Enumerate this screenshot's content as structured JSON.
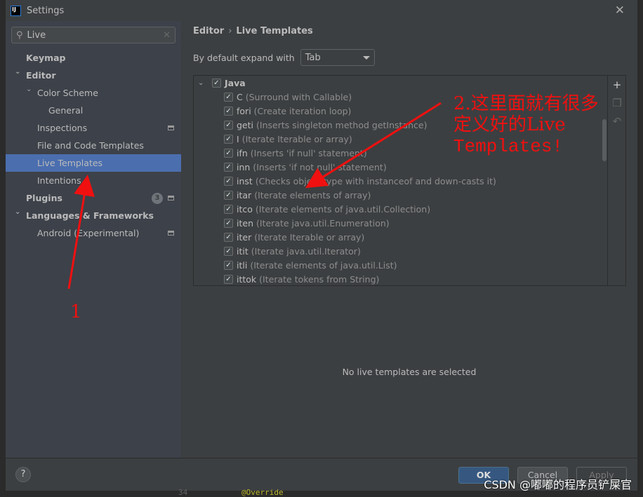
{
  "window": {
    "title": "Settings",
    "logo": "IJ"
  },
  "search": {
    "value": "Live"
  },
  "sidebar": {
    "items": [
      {
        "label": "Keymap",
        "level": 0,
        "bold": true
      },
      {
        "label": "Editor",
        "level": 0,
        "bold": true,
        "expanded": true
      },
      {
        "label": "Color Scheme",
        "level": 1,
        "expanded": true
      },
      {
        "label": "General",
        "level": 2
      },
      {
        "label": "Inspections",
        "level": 1,
        "project_icon": true
      },
      {
        "label": "File and Code Templates",
        "level": 1
      },
      {
        "label": "Live Templates",
        "level": 1,
        "selected": true
      },
      {
        "label": "Intentions",
        "level": 1
      },
      {
        "label": "Plugins",
        "level": 0,
        "bold": true,
        "badge": "3",
        "project_icon": true
      },
      {
        "label": "Languages & Frameworks",
        "level": 0,
        "bold": true,
        "expanded": true
      },
      {
        "label": "Android (Experimental)",
        "level": 1,
        "project_icon": true
      }
    ]
  },
  "breadcrumb": {
    "parent": "Editor",
    "current": "Live Templates"
  },
  "expand": {
    "label": "By default expand with",
    "value": "Tab"
  },
  "templates": {
    "group": "Java",
    "items": [
      {
        "abbr": "C",
        "desc": "(Surround with Callable)"
      },
      {
        "abbr": "fori",
        "desc": "(Create iteration loop)"
      },
      {
        "abbr": "geti",
        "desc": "(Inserts singleton method getInstance)"
      },
      {
        "abbr": "I",
        "desc": "(Iterate Iterable or array)"
      },
      {
        "abbr": "ifn",
        "desc": "(Inserts 'if null' statement)"
      },
      {
        "abbr": "inn",
        "desc": "(Inserts 'if not null' statement)"
      },
      {
        "abbr": "inst",
        "desc": "(Checks object type with instanceof and down-casts it)"
      },
      {
        "abbr": "itar",
        "desc": "(Iterate elements of array)"
      },
      {
        "abbr": "itco",
        "desc": "(Iterate elements of java.util.Collection)"
      },
      {
        "abbr": "iten",
        "desc": "(Iterate java.util.Enumeration)"
      },
      {
        "abbr": "iter",
        "desc": "(Iterate Iterable or array)"
      },
      {
        "abbr": "itit",
        "desc": "(Iterate java.util.Iterator)"
      },
      {
        "abbr": "itli",
        "desc": "(Iterate elements of java.util.List)"
      },
      {
        "abbr": "ittok",
        "desc": "(Iterate tokens from String)"
      }
    ]
  },
  "empty_message": "No live templates are selected",
  "buttons": {
    "help": "?",
    "ok": "OK",
    "cancel": "Cancel",
    "apply": "Apply"
  },
  "annotations": {
    "label1": "1",
    "line1": "2.这里面就有很多",
    "line2": "定义好的Live",
    "line3": "Templates!",
    "color": "#ff0000"
  },
  "watermark": "CSDN @嘟嘟的程序员铲屎官",
  "editor": {
    "line_no": "34",
    "code": "@Override"
  }
}
